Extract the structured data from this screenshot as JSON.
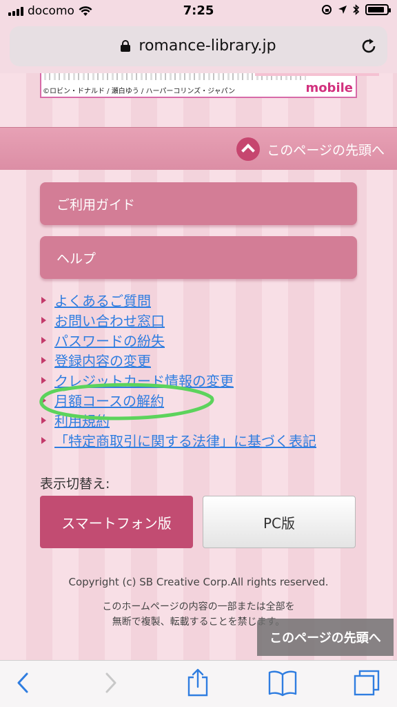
{
  "status_bar": {
    "carrier": "docomo",
    "time": "7:25",
    "battery_level": 0.9
  },
  "browser": {
    "url": "romance-library.jp",
    "icons": [
      "lock-icon",
      "reload-icon",
      "back-icon",
      "forward-icon",
      "share-icon",
      "bookmarks-icon",
      "tabs-icon"
    ]
  },
  "banner": {
    "credit": "©ロビン・ドナルド / 瀬白ゆう / ハーパーコリンズ・ジャパン",
    "brand": "mobile"
  },
  "page_top_link": "このページの先頭へ",
  "guide_buttons": {
    "usage_guide": "ご利用ガイド",
    "help": "ヘルプ"
  },
  "links": [
    "よくあるご質問",
    "お問い合わせ窓口",
    "パスワードの紛失",
    "登録内容の変更",
    "クレジットカード情報の変更",
    "月額コースの解約",
    "利用規約",
    "「特定商取引に関する法律」に基づく表記"
  ],
  "display_switch": {
    "label": "表示切替え:",
    "smartphone": "スマートフォン版",
    "pc": "PC版"
  },
  "footer": {
    "copyright": "Copyright (c) SB Creative Corp.All rights reserved.",
    "notice_line1": "このホームページの内容の一部または全部を",
    "notice_line2": "無断で複製、転載することを禁じます。"
  },
  "floating_top_button": "このページの先頭へ",
  "colors": {
    "accent": "#c24c72",
    "link": "#2f7de0",
    "annotation": "#5cd35c"
  }
}
